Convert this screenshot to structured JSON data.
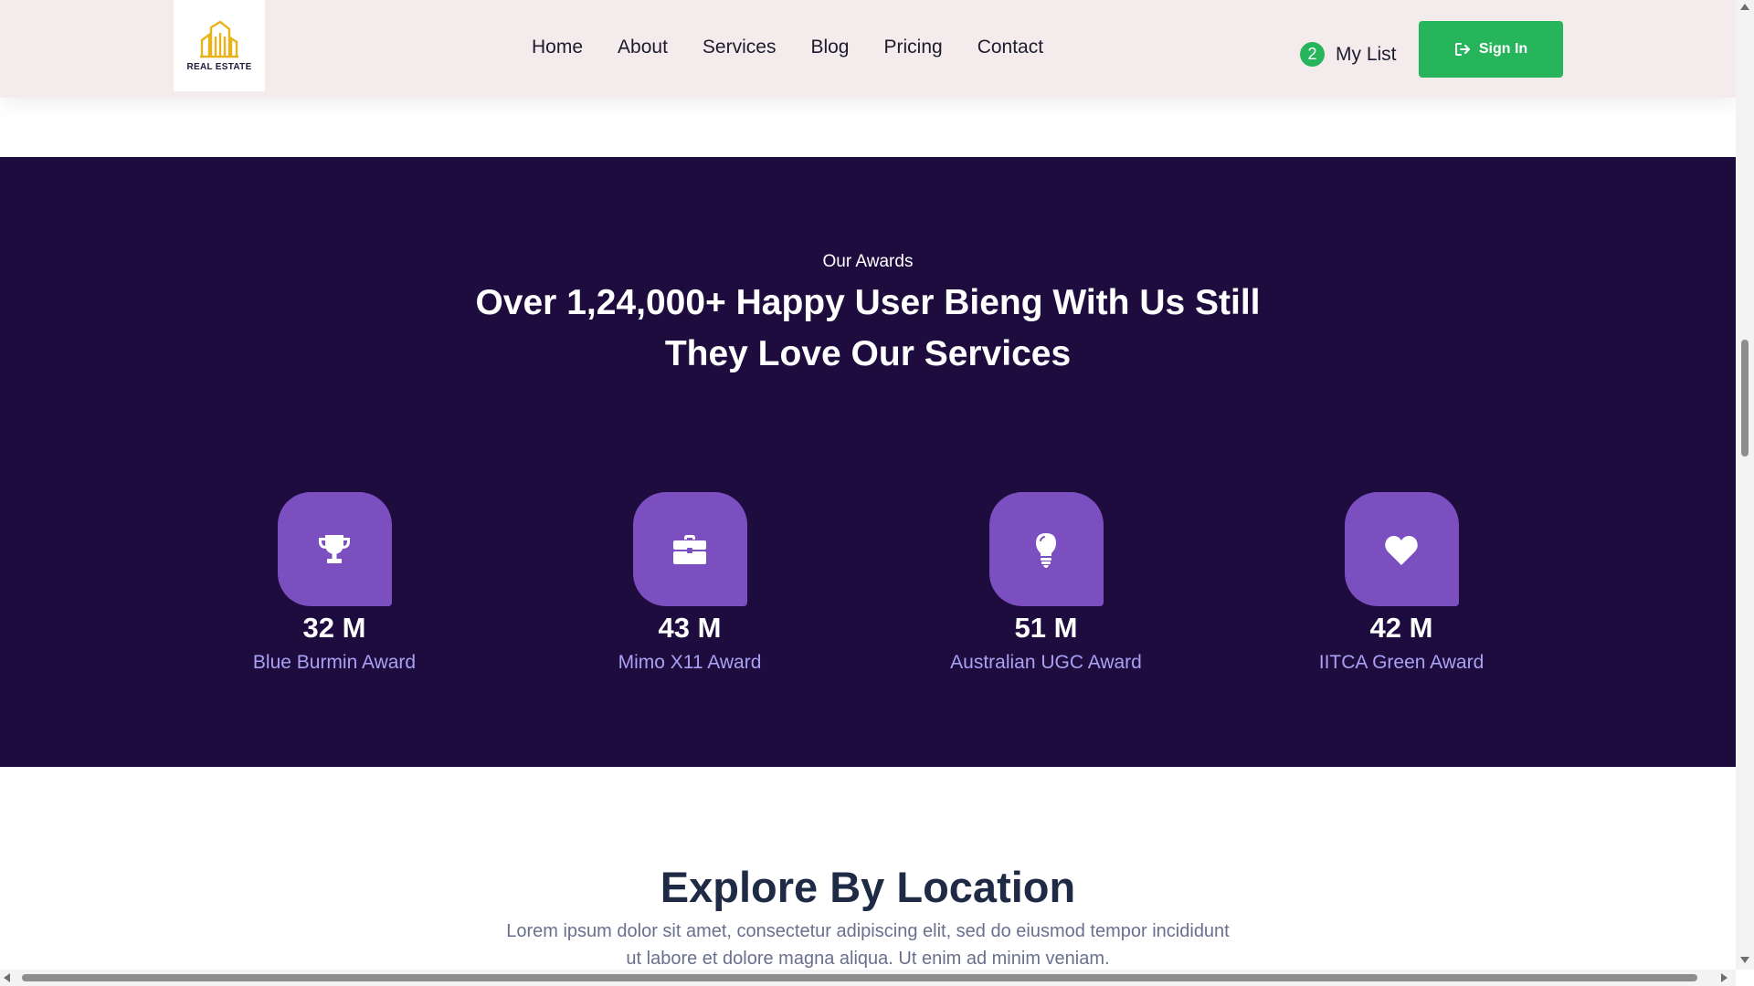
{
  "header": {
    "logo_text": "REAL ESTATE",
    "nav": [
      "Home",
      "About",
      "Services",
      "Blog",
      "Pricing",
      "Contact"
    ],
    "mylist_count": "2",
    "mylist_label": "My List",
    "signin_label": "Sign In",
    "accent_color": "#27b55c",
    "logo_color": "#e8b21a"
  },
  "awards": {
    "eyebrow": "Our Awards",
    "headline_line1": "Over 1,24,000+ Happy User Bieng With Us Still",
    "headline_line2": "They Love Our Services",
    "background": "#1e0c3f",
    "icon_bg": "#7c4fc1",
    "items": [
      {
        "icon": "trophy-icon",
        "value": "32 M",
        "name": "Blue Burmin Award"
      },
      {
        "icon": "briefcase-icon",
        "value": "43 M",
        "name": "Mimo X11 Award"
      },
      {
        "icon": "lightbulb-icon",
        "value": "51 M",
        "name": "Australian UGC Award"
      },
      {
        "icon": "heart-icon",
        "value": "42 M",
        "name": "IITCA Green Award"
      }
    ]
  },
  "explore": {
    "title": "Explore By Location",
    "desc_line1": "Lorem ipsum dolor sit amet, consectetur adipiscing elit, sed do eiusmod tempor incididunt",
    "desc_line2": "ut labore et dolore magna aliqua. Ut enim ad minim veniam."
  }
}
